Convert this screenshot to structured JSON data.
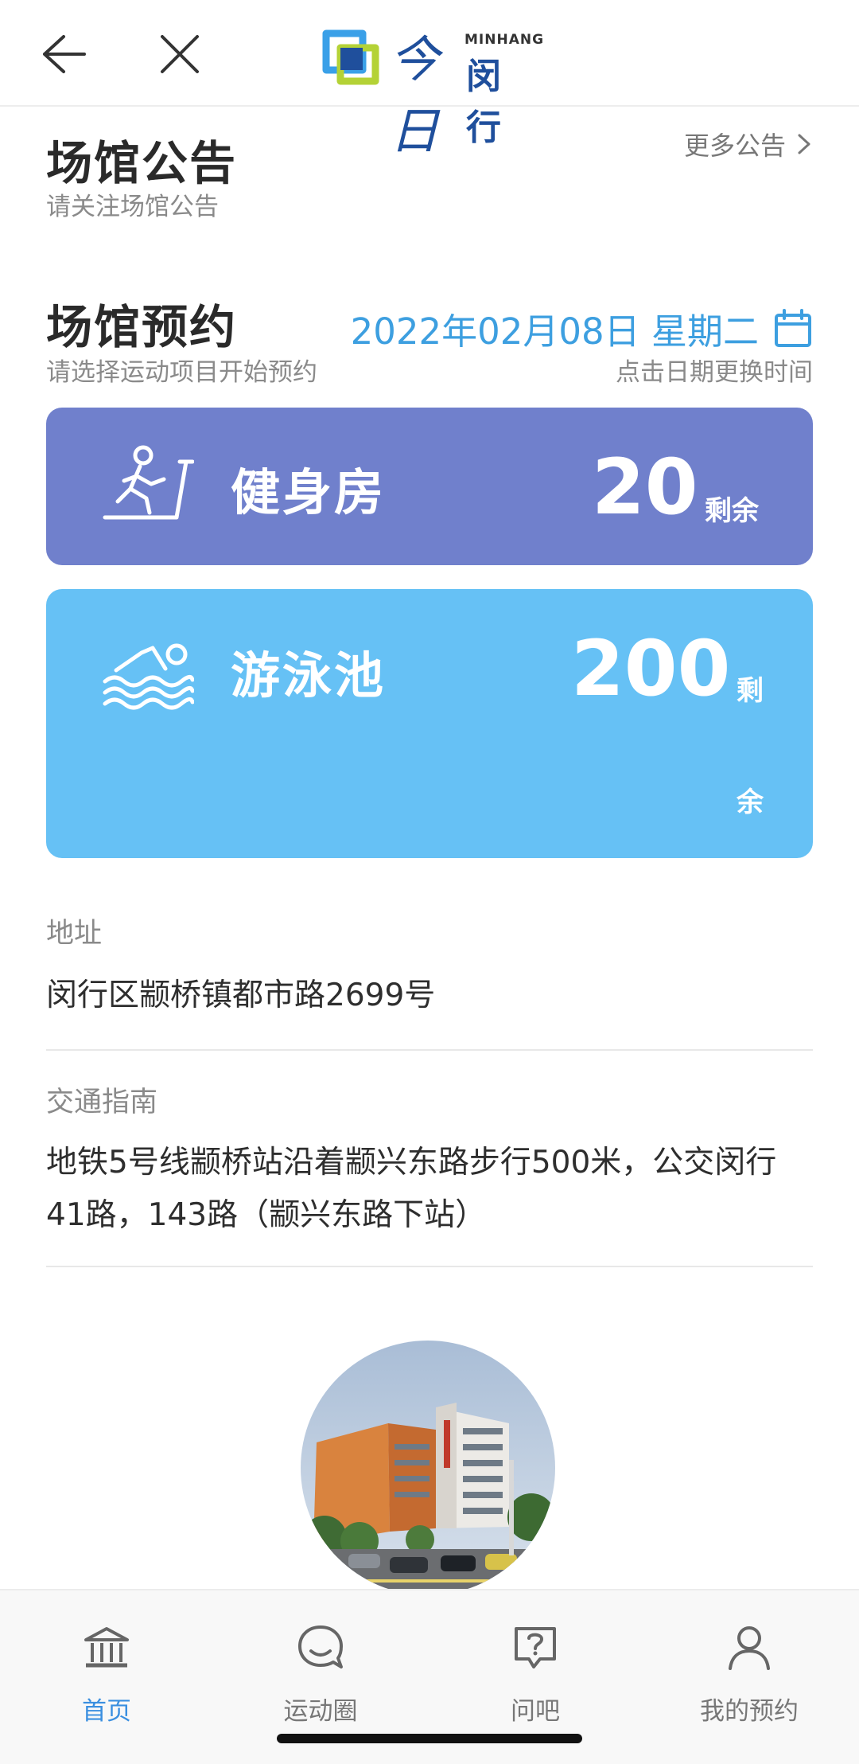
{
  "app": {
    "logo_en": "MINHANG",
    "logo_cn": "闵行",
    "logo_glyph": "今日"
  },
  "announcement": {
    "title": "场馆公告",
    "subtitle": "请关注场馆公告",
    "more_label": "更多公告"
  },
  "booking": {
    "title": "场馆预约",
    "subtitle": "请选择运动项目开始预约",
    "date": "2022年02月08日 星期二",
    "date_hint": "点击日期更换时间",
    "venues": [
      {
        "name": "健身房",
        "remaining": "20",
        "remaining_label": "剩余",
        "icon": "treadmill-icon",
        "color": "#7080cc"
      },
      {
        "name": "游泳池",
        "remaining": "200",
        "remaining_label_1": "剩",
        "remaining_label_2": "余",
        "icon": "swimmer-icon",
        "color": "#66c1f5"
      }
    ]
  },
  "info": {
    "address_label": "地址",
    "address": "闵行区颛桥镇都市路2699号",
    "transport_label": "交通指南",
    "transport": "地铁5号线颛桥站沿着颛兴东路步行500米，公交闵行41路，143路（颛兴东路下站）"
  },
  "nav": {
    "items": [
      {
        "label": "首页",
        "icon": "bank-icon",
        "active": true
      },
      {
        "label": "运动圈",
        "icon": "chat-bubble-icon"
      },
      {
        "label": "问吧",
        "icon": "question-icon"
      },
      {
        "label": "我的预约",
        "icon": "user-icon"
      }
    ],
    "active_color": "#3a8fe0"
  }
}
